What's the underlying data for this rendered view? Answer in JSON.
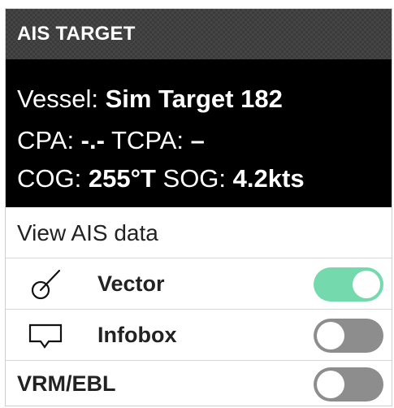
{
  "window": {
    "title": "AIS TARGET"
  },
  "info": {
    "vessel_label": "Vessel: ",
    "vessel_value": "Sim Target 182",
    "cpa_label": "CPA: ",
    "cpa_value": "-.-",
    "tcpa_label": " TCPA: ",
    "tcpa_value": "–",
    "cog_label": "COG: ",
    "cog_value": "255°T",
    "sog_label": " SOG: ",
    "sog_value": "4.2kts"
  },
  "menu": {
    "view_ais_data": "View AIS data",
    "vector": {
      "label": "Vector",
      "icon": "vector-icon",
      "state": "on"
    },
    "infobox": {
      "label": "Infobox",
      "icon": "infobox-icon",
      "state": "off"
    },
    "vrm_ebl": {
      "label": "VRM/EBL",
      "state": "off"
    }
  },
  "colors": {
    "toggle_on": "#74d9ad",
    "toggle_off": "#8d8d8d",
    "header_bg": "#3b3b3b",
    "info_bg": "#000000"
  }
}
